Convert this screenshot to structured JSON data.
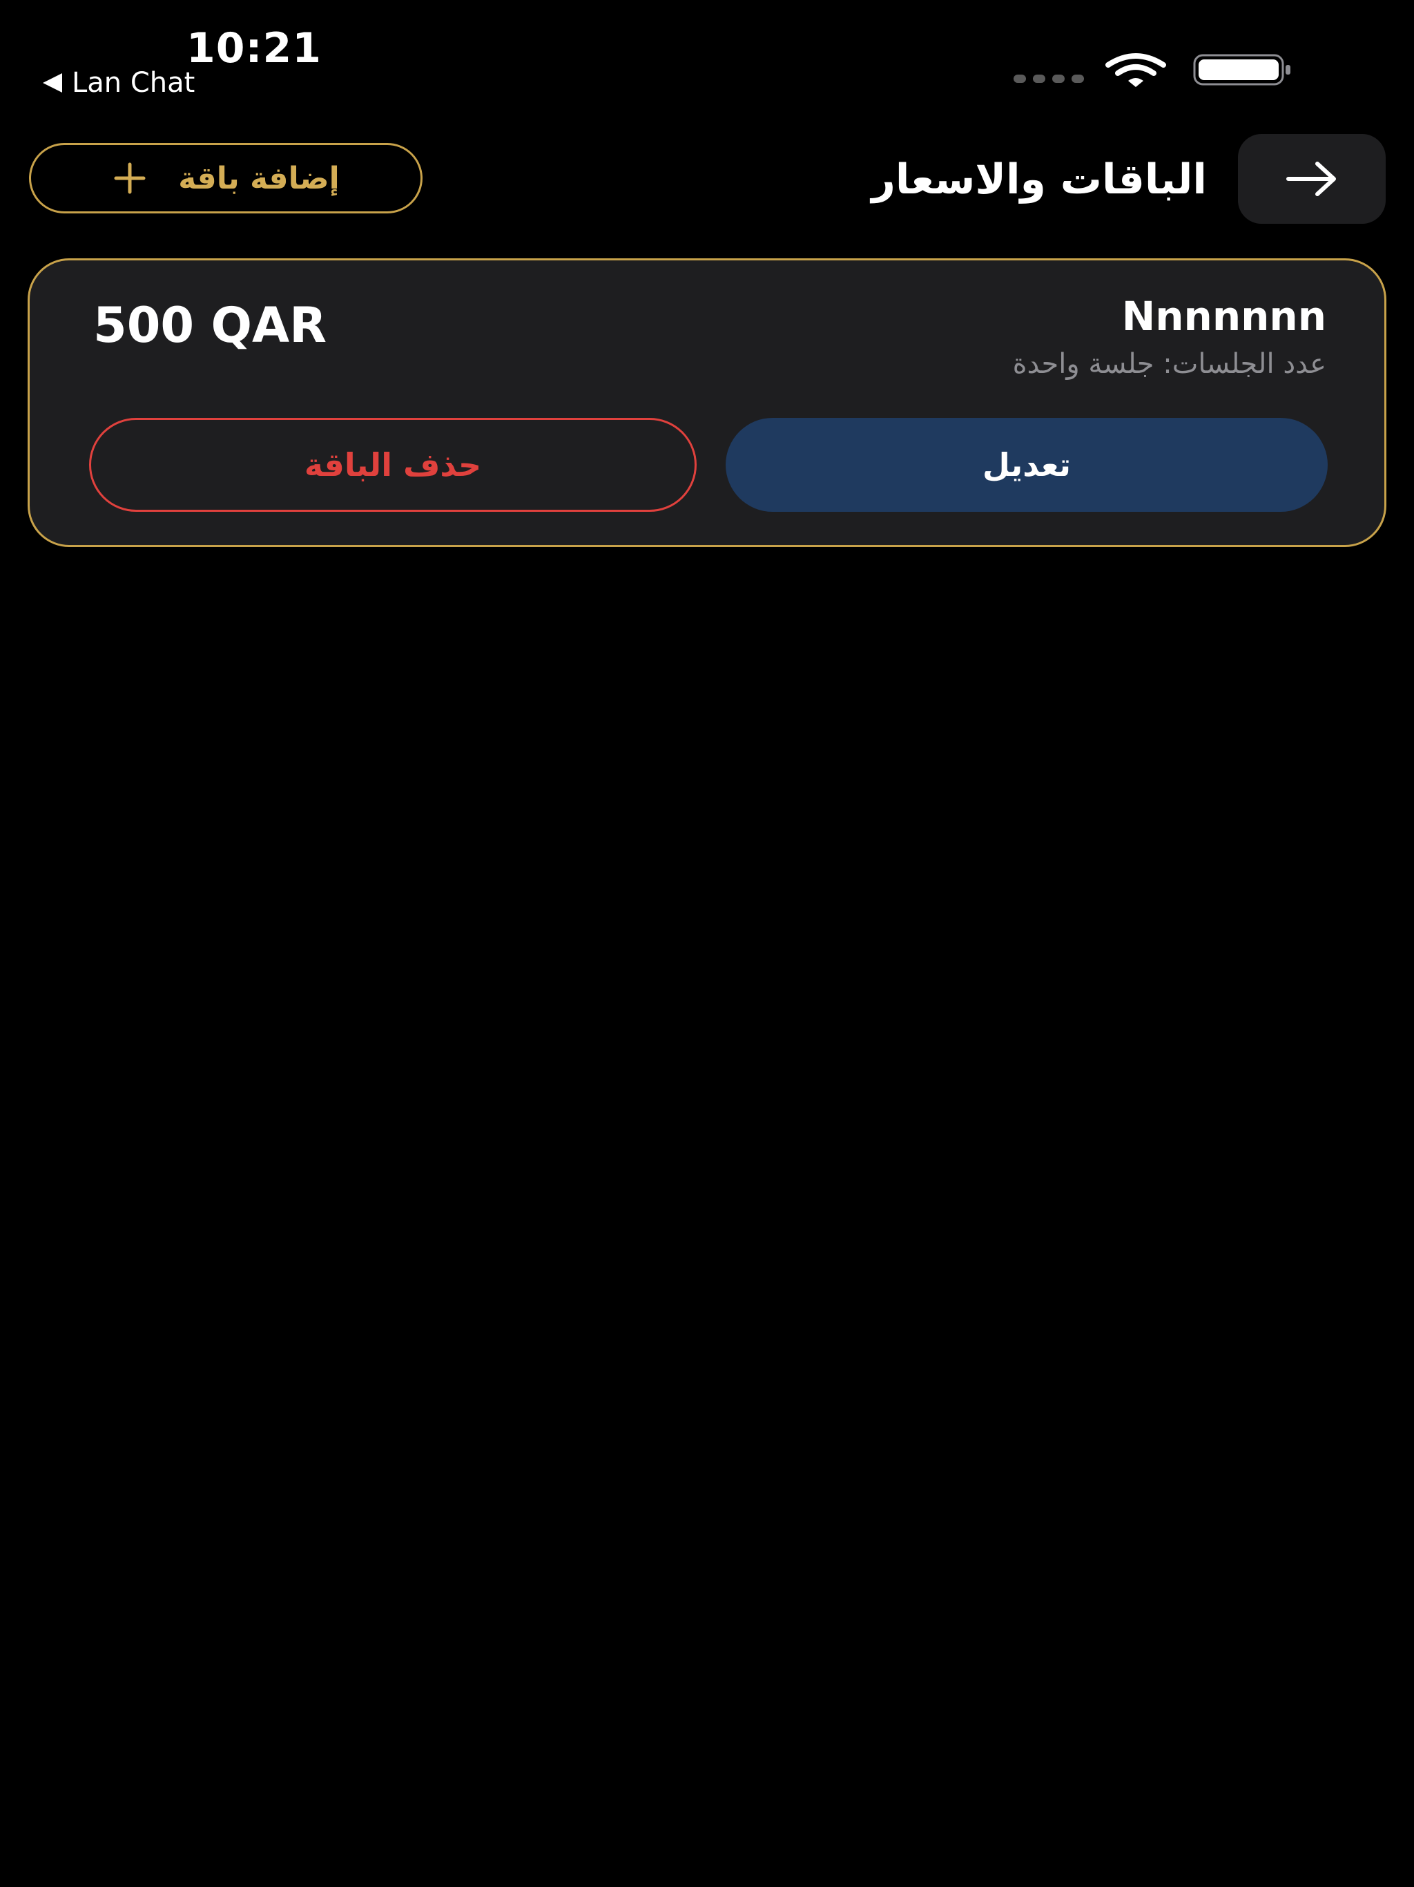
{
  "status_bar": {
    "time": "10:21",
    "back_app": "Lan Chat"
  },
  "header": {
    "title": "الباقات والاسعار",
    "add_button_label": "إضافة باقة"
  },
  "packages": [
    {
      "name": "Nnnnnnn",
      "sessions": "عدد الجلسات: جلسة واحدة",
      "price": "500 QAR",
      "edit_label": "تعديل",
      "delete_label": "حذف الباقة"
    }
  ],
  "icons": {
    "back": "arrow-right-icon",
    "add": "plus-icon",
    "wifi": "wifi-icon",
    "battery": "battery-icon"
  },
  "colors": {
    "background": "#000000",
    "card": "#1e1e20",
    "accent_gold": "#c8a24a",
    "edit_blue": "#1f3a5f",
    "delete_red": "#e0413d",
    "secondary_text": "#8e8e93"
  }
}
